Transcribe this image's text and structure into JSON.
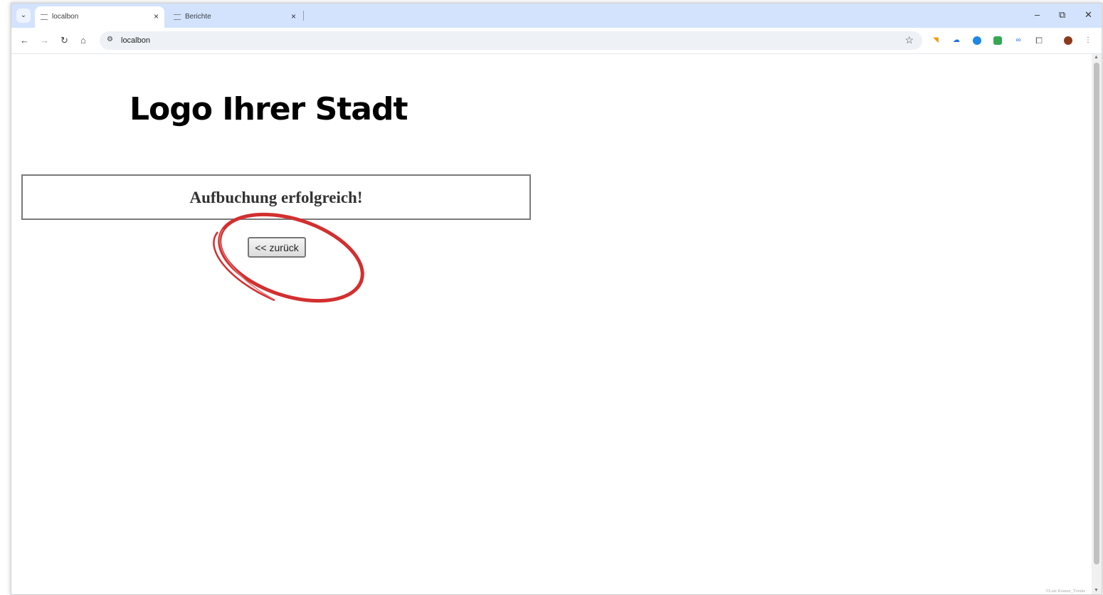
{
  "browser": {
    "tabs": [
      {
        "title": "localbon",
        "active": true
      },
      {
        "title": "Berichte",
        "active": false
      }
    ],
    "tab_close_glyph": "×",
    "address": "localbon",
    "window_controls": {
      "minimize": "–",
      "restore": "⧉",
      "close": "✕"
    },
    "nav": {
      "back": "←",
      "forward": "→",
      "reload": "↻",
      "home": "⌂"
    },
    "extension_colors": [
      "#f29900",
      "#1a73e8",
      "#1e88e5",
      "#34a853",
      "#5f6368"
    ]
  },
  "page": {
    "logo_text": "Logo Ihrer Stadt",
    "message": "Aufbuchung erfolgreich!",
    "back_button": "<< zurück",
    "watermark": "©Lutz Kramer_Tronke",
    "annotation_color": "#d32f2f"
  }
}
